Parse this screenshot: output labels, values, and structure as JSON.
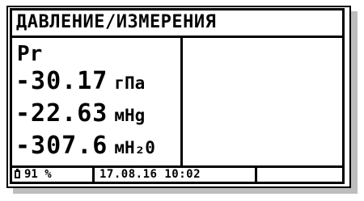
{
  "screen": {
    "title": "ДАВЛЕНИЕ/ИЗМЕРЕНИЯ",
    "channel": "Pr",
    "readings": [
      {
        "value": "-30.17",
        "unit": "гПа"
      },
      {
        "value": "-22.63",
        "unit": "мНg"
      },
      {
        "value": "-307.6",
        "unit": "мН₂0"
      }
    ]
  },
  "status": {
    "battery": "91 %",
    "datetime": "17.08.16 10:02",
    "extra": ""
  }
}
